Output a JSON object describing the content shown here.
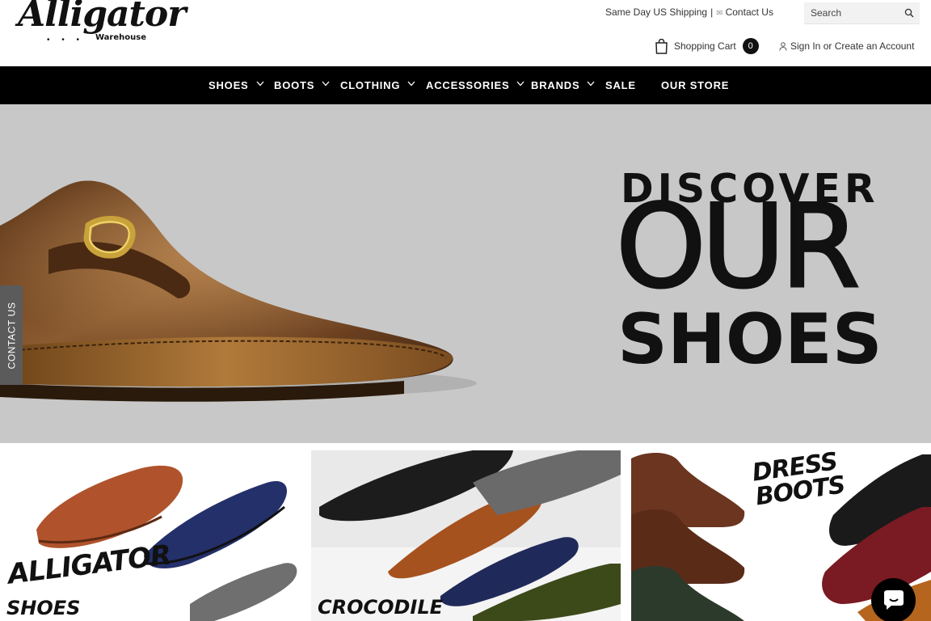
{
  "logo": {
    "name": "Alligator",
    "subtitle": "Warehouse",
    "dots": "• • •"
  },
  "topbar": {
    "shipping": "Same Day US Shipping",
    "separator": "|",
    "contact": "Contact Us"
  },
  "search": {
    "placeholder": "Search",
    "icon": "search-icon"
  },
  "cart": {
    "label": "Shopping Cart",
    "count": "0",
    "icon": "shopping-bag-icon"
  },
  "account": {
    "label": "Sign In or Create an Account",
    "icon": "user-icon"
  },
  "nav": {
    "items": [
      {
        "label": "SHOES",
        "dropdown": true
      },
      {
        "label": "BOOTS",
        "dropdown": true
      },
      {
        "label": "CLOTHING",
        "dropdown": true
      },
      {
        "label": "ACCESSORIES",
        "dropdown": true
      },
      {
        "label": "BRANDS",
        "dropdown": true
      },
      {
        "label": "SALE",
        "dropdown": false
      },
      {
        "label": "OUR STORE",
        "dropdown": false
      }
    ]
  },
  "hero": {
    "line1": "DISCOVER",
    "line2": "OUR",
    "line3": "SHOES",
    "background": "#c8c8c8",
    "image": "brown-monk-strap-shoe"
  },
  "contact_tab": {
    "label": "CONTACT US"
  },
  "tiles": [
    {
      "label": "ALLIGATOR SHOES",
      "line1": "ALLIGATOR",
      "line2": "SHOES"
    },
    {
      "label": "CROCODILE"
    },
    {
      "label": "DRESS BOOTS",
      "line1": "DRESS",
      "line2": "BOOTS"
    }
  ],
  "chat": {
    "icon": "chat-bubble-icon"
  },
  "colors": {
    "nav_bg": "#000000",
    "nav_text": "#ffffff",
    "accent": "#111111"
  }
}
